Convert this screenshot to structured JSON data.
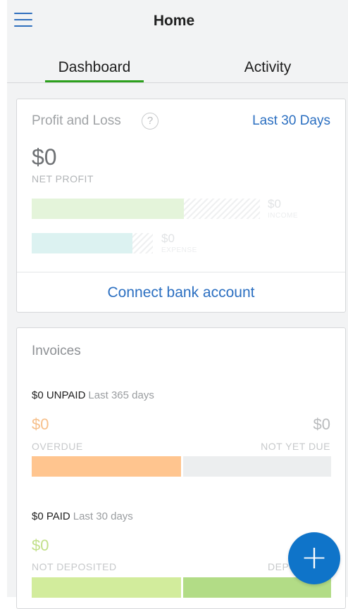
{
  "header": {
    "title": "Home",
    "menu_icon": "hamburger-menu-icon"
  },
  "tabs": [
    {
      "label": "Dashboard",
      "active": true
    },
    {
      "label": "Activity",
      "active": false
    }
  ],
  "profit_loss": {
    "title": "Profit and Loss",
    "help_glyph": "?",
    "period": "Last 30 Days",
    "net_value": "$0",
    "net_label": "NET PROFIT",
    "income": {
      "value": "$0",
      "label": "INCOME"
    },
    "expense": {
      "value": "$0",
      "label": "EXPENSE"
    },
    "connect_label": "Connect bank account"
  },
  "invoices": {
    "title": "Invoices",
    "unpaid": {
      "summary": "$0 UNPAID",
      "period": "Last 365 days",
      "overdue_value": "$0",
      "overdue_label": "OVERDUE",
      "not_due_value": "$0",
      "not_due_label": "NOT YET DUE"
    },
    "paid": {
      "summary": "$0 PAID",
      "period": "Last 30 days",
      "not_deposited_value": "$0",
      "not_deposited_label": "NOT DEPOSITED",
      "deposited_label": "DEPOSITED"
    }
  },
  "fab": {
    "glyph": "+",
    "icon": "plus-icon"
  },
  "colors": {
    "accent_blue": "#2b6fc1",
    "tab_green": "#2ca01c",
    "overdue_orange": "#ffc58f",
    "not_due_gray": "#eceeef",
    "not_deposited_green": "#d2ec9c",
    "deposited_green": "#b2dc86",
    "fab_blue": "#0f74c9"
  }
}
